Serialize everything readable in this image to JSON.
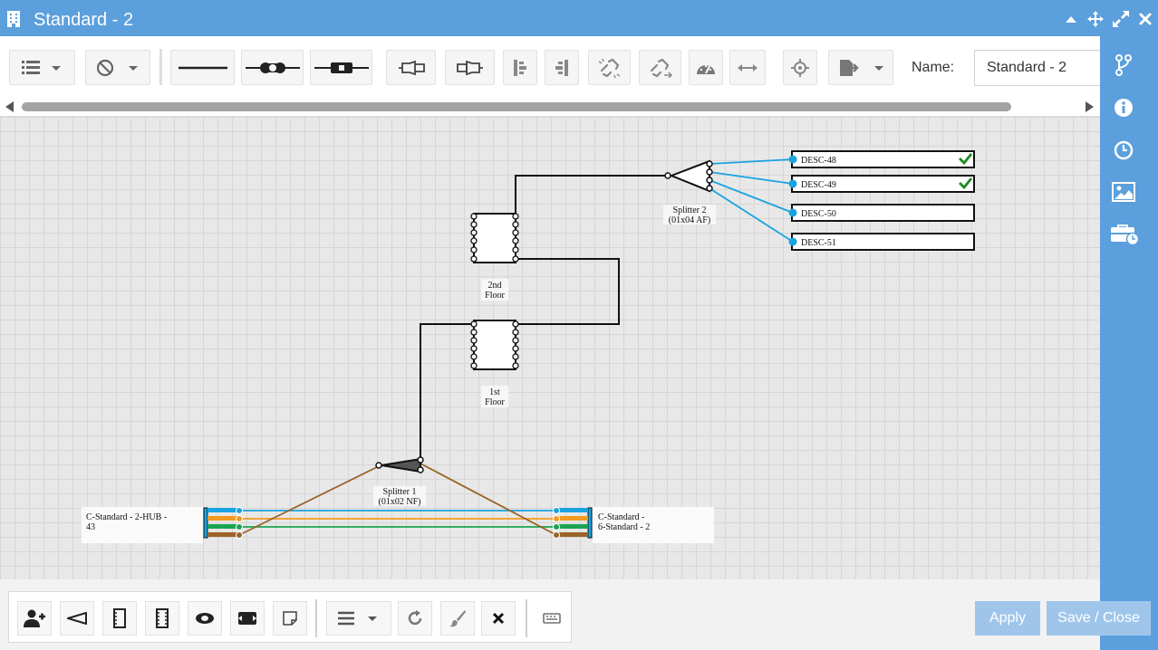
{
  "window": {
    "title": "Standard - 2"
  },
  "toolbar": {
    "name_label": "Name:",
    "name_value": "Standard - 2"
  },
  "diagram": {
    "splitter2": {
      "line1": "Splitter 2",
      "line2": "(01x04 AF)"
    },
    "floor2": {
      "line1": "2nd",
      "line2": "Floor"
    },
    "floor1": {
      "line1": "1st",
      "line2": "Floor"
    },
    "splitter1": {
      "line1": "Splitter 1",
      "line2": "(01x02 NF)"
    },
    "cable_left": {
      "line1": "C-Standard - 2-HUB -",
      "line2": "43"
    },
    "cable_right": {
      "line1": "C-Standard -",
      "line2": "6-Standard - 2"
    },
    "outputs": [
      {
        "label": "DESC-48",
        "checked": true
      },
      {
        "label": "DESC-49",
        "checked": true
      },
      {
        "label": "DESC-50",
        "checked": false
      },
      {
        "label": "DESC-51",
        "checked": false
      }
    ]
  },
  "actions": {
    "apply": "Apply",
    "save_close": "Save / Close"
  },
  "colors": {
    "accent": "#5b9fdc",
    "fiber_blue": "#1aa3e0",
    "fiber_orange": "#f39a1e",
    "fiber_green": "#1aa352",
    "fiber_brown": "#9b6327",
    "check_green": "#1f8a1f",
    "button_disabled": "#9fc6ea"
  }
}
